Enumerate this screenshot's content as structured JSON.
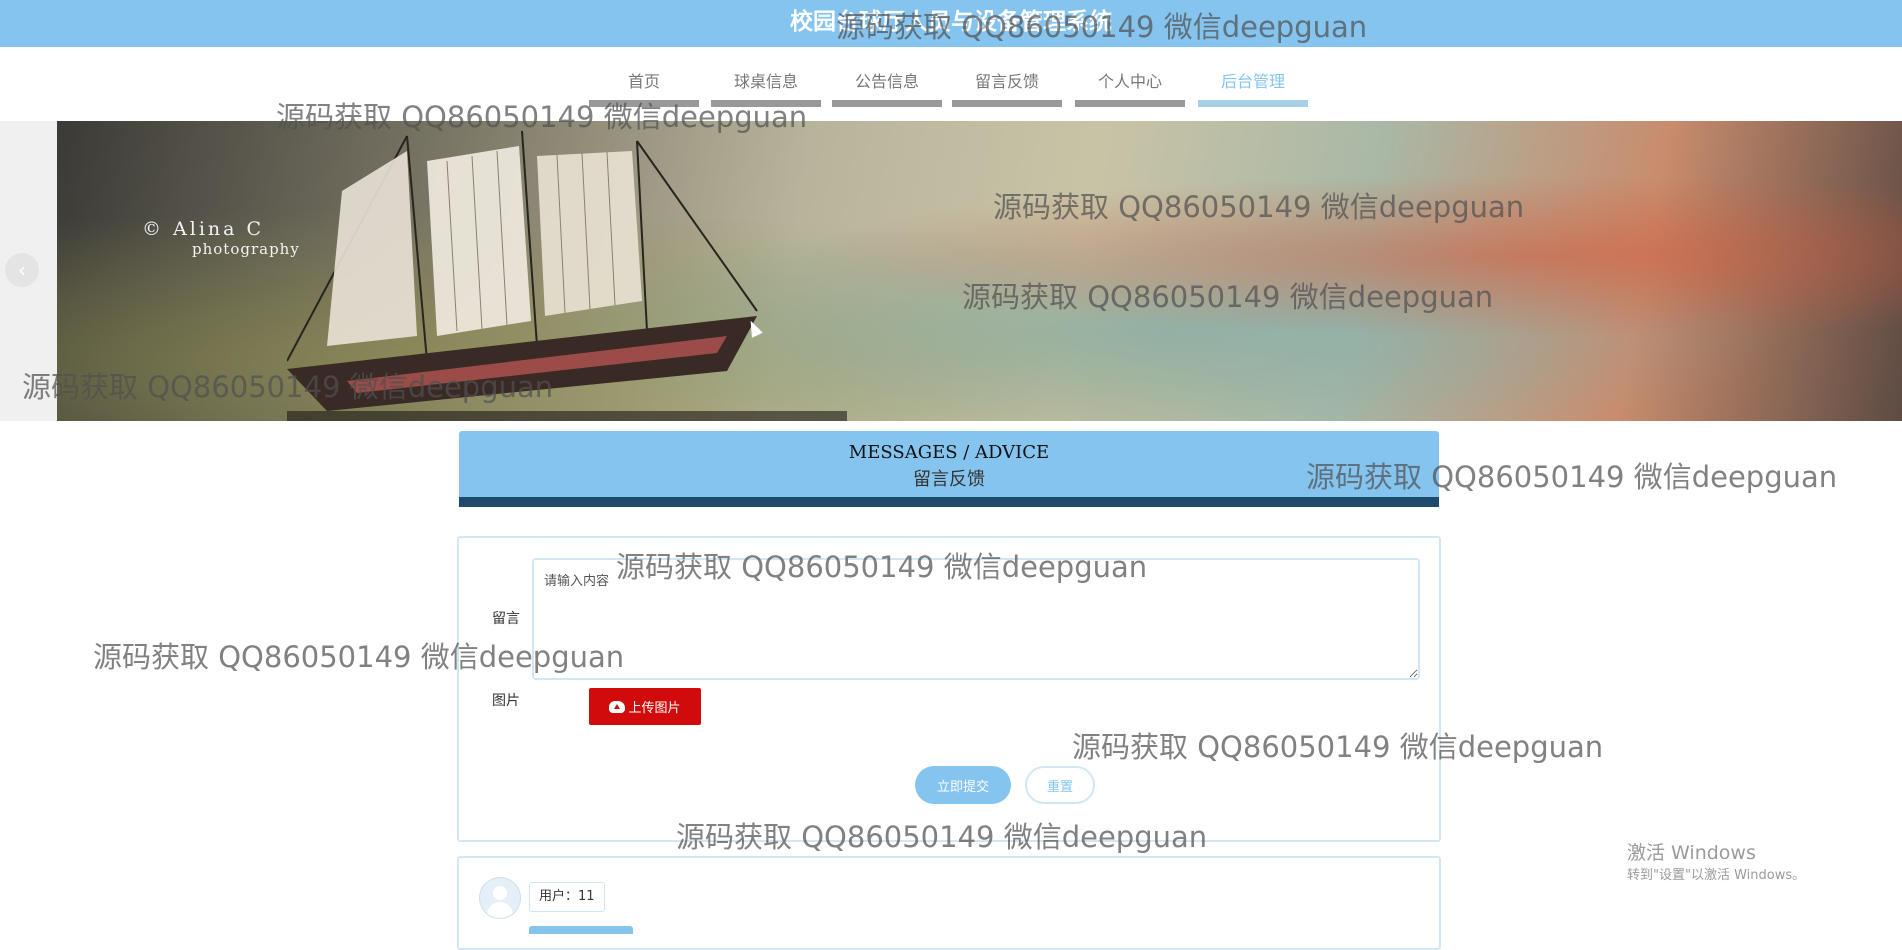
{
  "header": {
    "site_title": "校园台球厅人员与设备管理系统"
  },
  "nav": {
    "items": [
      {
        "label": "首页",
        "active": false
      },
      {
        "label": "球桌信息",
        "active": false
      },
      {
        "label": "公告信息",
        "active": false
      },
      {
        "label": "留言反馈",
        "active": false
      },
      {
        "label": "个人中心",
        "active": false
      },
      {
        "label": "后台管理",
        "active": true
      }
    ]
  },
  "banner": {
    "credit_line1": "© Alina C",
    "credit_line2": "photography"
  },
  "section": {
    "title_en": "MESSAGES / ADVICE",
    "title_cn": "留言反馈"
  },
  "form": {
    "message_label": "留言",
    "message_placeholder": "请输入内容",
    "image_label": "图片",
    "upload_button": "上传图片",
    "submit_button": "立即提交",
    "reset_button": "重置"
  },
  "comments": [
    {
      "user": "用户：11"
    }
  ],
  "watermark": {
    "text": "源码获取 QQ86050149 微信deepguan"
  },
  "system": {
    "activate_title": "激活 Windows",
    "activate_sub": "转到\"设置\"以激活 Windows。"
  },
  "colors": {
    "primary": "#85c4ef",
    "dark_bar": "#1e4a6d",
    "upload_red": "#d10b0b",
    "border": "#d2e7f5"
  }
}
